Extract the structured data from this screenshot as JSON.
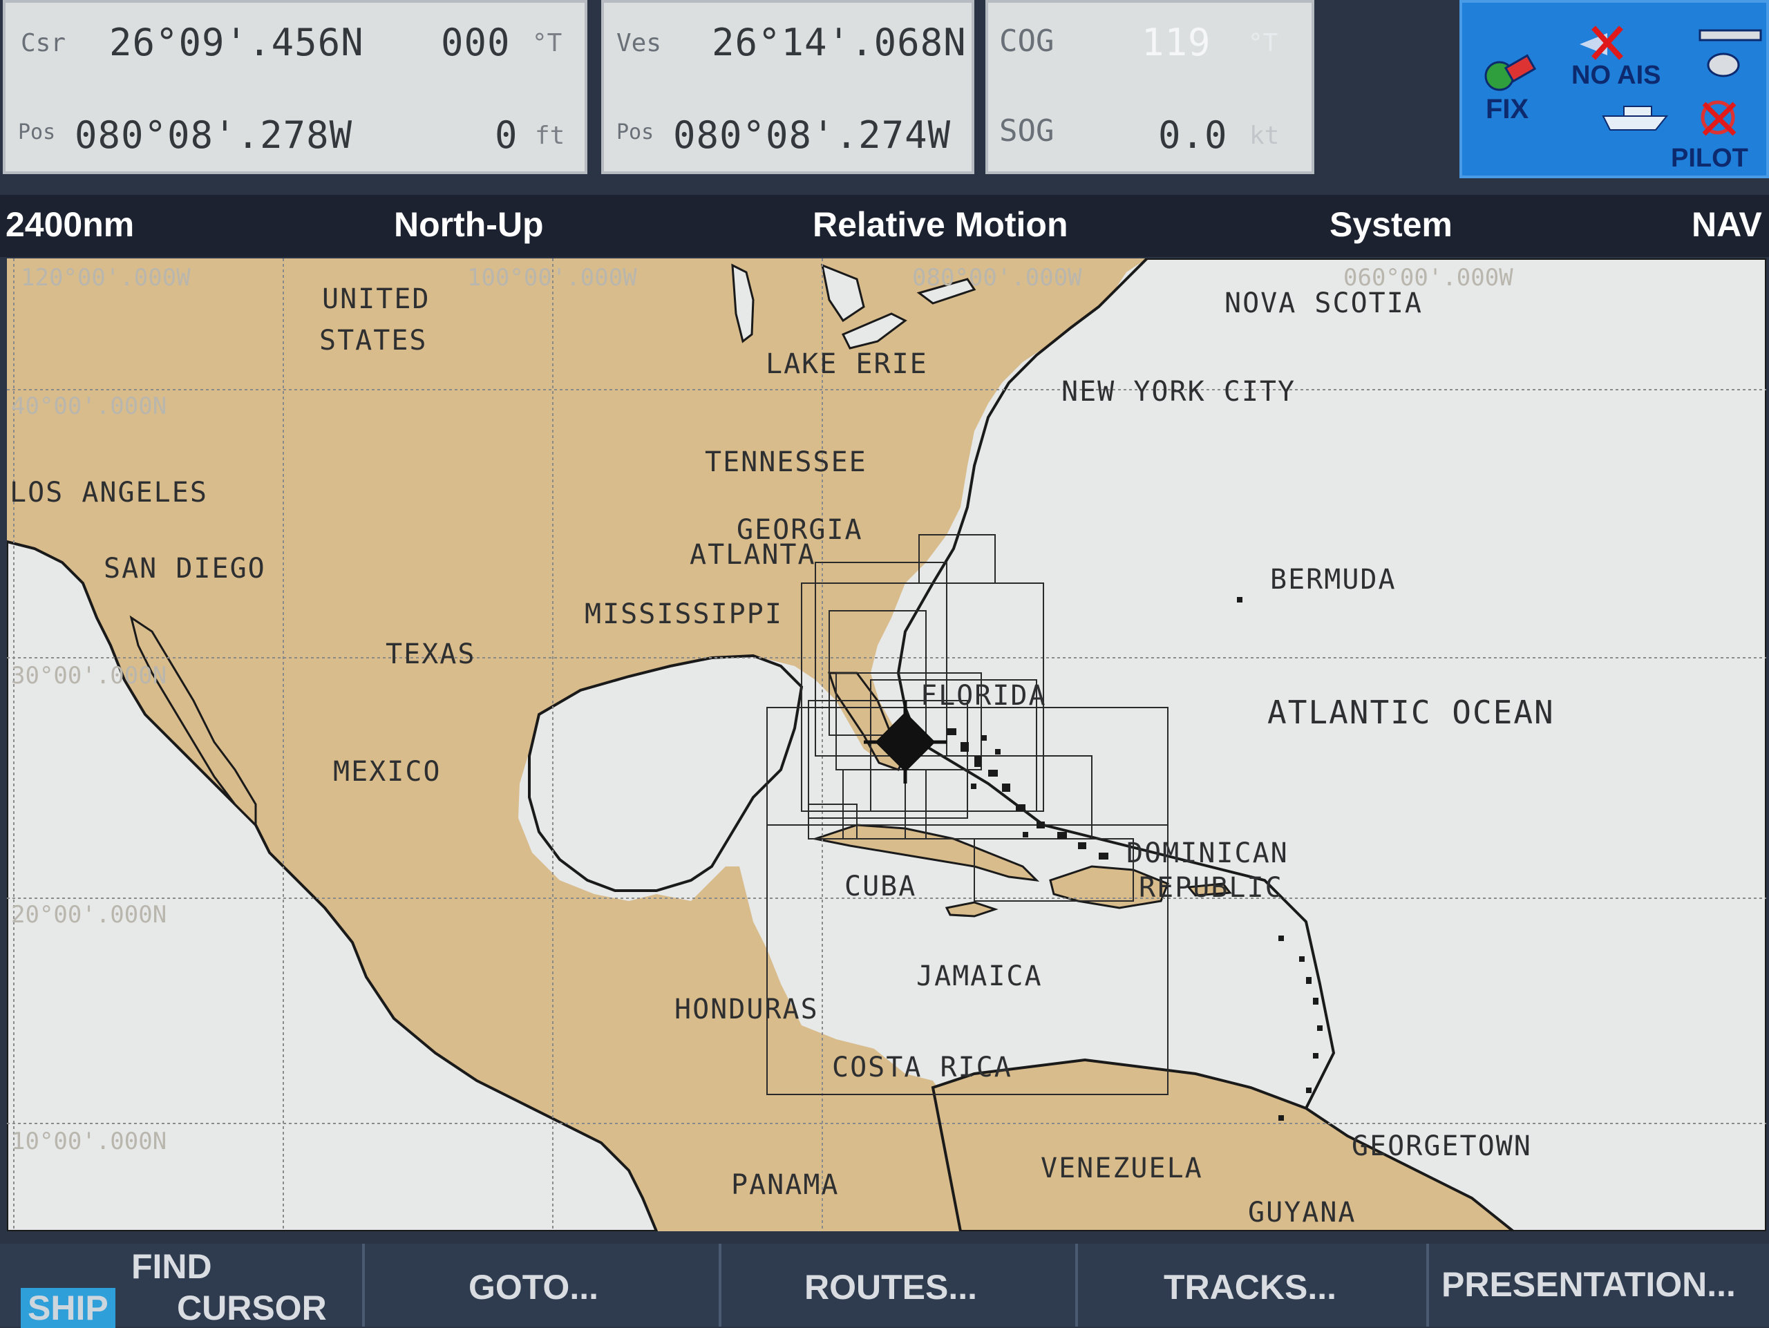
{
  "panels": {
    "cursor": {
      "label": "Csr",
      "pos_label": "Pos",
      "lat": "26°09'.456N",
      "lon": "080°08'.278W",
      "bearing": "000",
      "bearing_unit": "°T",
      "depth": "0",
      "depth_unit": "ft"
    },
    "vessel": {
      "label": "Ves",
      "pos_label": "Pos",
      "lat": "26°14'.068N",
      "lon": "080°08'.274W"
    },
    "motion": {
      "cog_label": "COG",
      "cog_value": "119",
      "cog_unit": "°T",
      "sog_label": "SOG",
      "sog_value": "0.0",
      "sog_unit": "kt"
    },
    "status": {
      "fix": "FIX",
      "ais": "NO AIS",
      "pilot": "PILOT"
    }
  },
  "header": {
    "range": "2400nm",
    "orientation": "North-Up",
    "motion_mode": "Relative Motion",
    "system": "System",
    "nav": "NAV"
  },
  "map": {
    "grid_labels": {
      "lon_120": "120°00'.000W",
      "lon_100": "100°00'.000W",
      "lon_080": "080°00'.000W",
      "lon_060": "060°00'.000W",
      "lat_40": "40°00'.000N",
      "lat_30": "30°00'.000N",
      "lat_20": "20°00'.000N",
      "lat_10": "10°00'.000N"
    },
    "places": {
      "united": "UNITED",
      "states": "STATES",
      "nova_scotia": "NOVA SCOTIA",
      "lake_erie": "LAKE ERIE",
      "new_york_city": "NEW YORK CITY",
      "tennessee": "TENNESSEE",
      "los_angeles": "LOS ANGELES",
      "san_diego": "SAN DIEGO",
      "georgia": "GEORGIA",
      "atlanta": "ATLANTA",
      "bermuda": "BERMUDA",
      "mississippi": "MISSISSIPPI",
      "texas": "TEXAS",
      "florida": "FLORIDA",
      "atlantic_ocean": "ATLANTIC OCEAN",
      "mexico": "MEXICO",
      "dominican": "DOMINICAN",
      "republic": "REPUBLIC",
      "cuba": "CUBA",
      "jamaica": "JAMAICA",
      "honduras": "HONDURAS",
      "costa_rica": "COSTA RICA",
      "georgetown": "GEORGETOWN",
      "venezuela": "VENEZUELA",
      "panama": "PANAMA",
      "guyana": "GUYANA"
    },
    "colors": {
      "land": "#d9bc8c",
      "water": "#e7e8e8",
      "coast": "#1a1a1a"
    }
  },
  "softkeys": {
    "find_ship": "SHIP",
    "find_label": "FIND",
    "find_cursor": "CURSOR",
    "goto": "GOTO...",
    "routes": "ROUTES...",
    "tracks": "TRACKS...",
    "presentation": "PRESENTATION..."
  }
}
